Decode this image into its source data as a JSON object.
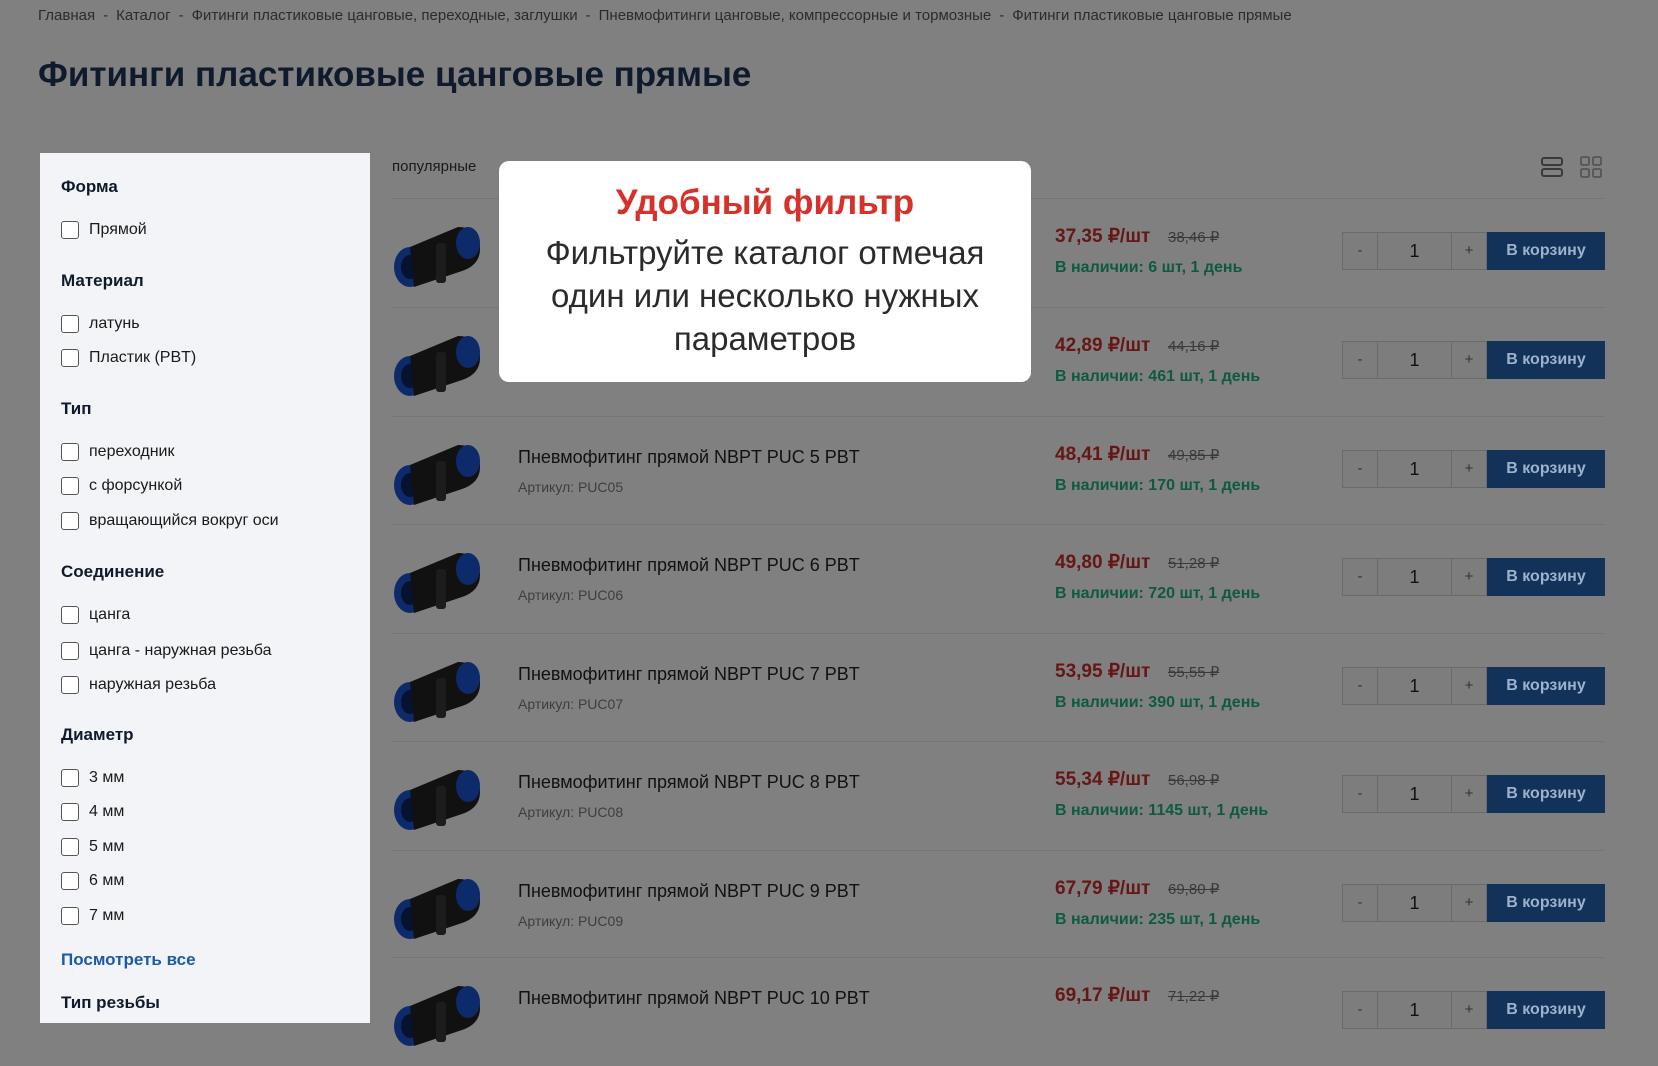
{
  "breadcrumb": [
    "Главная",
    "Каталог",
    "Фитинги пластиковые цанговые, переходные, заглушки",
    "Пневмофитинги цанговые, компрессорные и тормозные",
    "Фитинги пластиковые цанговые прямые"
  ],
  "page_title": "Фитинги пластиковые цанговые прямые",
  "filters": {
    "groups": [
      {
        "title": "Форма",
        "options": [
          "Прямой"
        ]
      },
      {
        "title": "Материал",
        "options": [
          "латунь",
          "Пластик (PBT)"
        ]
      },
      {
        "title": "Тип",
        "options": [
          "переходник",
          "с форсункой",
          "вращающийся вокруг оси"
        ]
      },
      {
        "title": "Соединение",
        "options": [
          "цанга",
          "цанга - наружная резьба",
          "наружная резьба"
        ]
      },
      {
        "title": "Диаметр",
        "options": [
          "3 мм",
          "4 мм",
          "5 мм",
          "6 мм",
          "7 мм"
        ]
      }
    ],
    "see_all": "Посмотреть все",
    "next_group_partial": "Тип резьбы"
  },
  "sort_label": "популярные",
  "view_icons": {
    "list": "list-view-icon",
    "grid": "grid-view-icon"
  },
  "products": [
    {
      "name": "",
      "sku": "",
      "price": "37,35 ₽/шт",
      "old_price": "38,46 ₽",
      "stock": "В наличии: 6 шт, 1 день",
      "qty": "1"
    },
    {
      "name": "",
      "sku": "",
      "price": "42,89 ₽/шт",
      "old_price": "44,16 ₽",
      "stock": "В наличии: 461 шт, 1 день",
      "qty": "1"
    },
    {
      "name": "Пневмофитинг прямой NBPT PUC 5 PBT",
      "sku": "Артикул: PUC05",
      "price": "48,41 ₽/шт",
      "old_price": "49,85 ₽",
      "stock": "В наличии: 170 шт, 1 день",
      "qty": "1"
    },
    {
      "name": "Пневмофитинг прямой NBPT PUC 6 PBT",
      "sku": "Артикул: PUC06",
      "price": "49,80 ₽/шт",
      "old_price": "51,28 ₽",
      "stock": "В наличии: 720 шт, 1 день",
      "qty": "1"
    },
    {
      "name": "Пневмофитинг прямой NBPT PUC 7 PBT",
      "sku": "Артикул: PUC07",
      "price": "53,95 ₽/шт",
      "old_price": "55,55 ₽",
      "stock": "В наличии: 390 шт, 1 день",
      "qty": "1"
    },
    {
      "name": "Пневмофитинг прямой NBPT PUC 8 PBT",
      "sku": "Артикул: PUC08",
      "price": "55,34 ₽/шт",
      "old_price": "56,98 ₽",
      "stock": "В наличии: 1145 шт, 1 день",
      "qty": "1"
    },
    {
      "name": "Пневмофитинг прямой NBPT PUC 9 PBT",
      "sku": "Артикул: PUC09",
      "price": "67,79 ₽/шт",
      "old_price": "69,80 ₽",
      "stock": "В наличии: 235 шт, 1 день",
      "qty": "1"
    },
    {
      "name": "Пневмофитинг прямой NBPT PUC 10 PBT",
      "sku": "",
      "price": "69,17 ₽/шт",
      "old_price": "71,22 ₽",
      "stock": "",
      "qty": "1"
    }
  ],
  "qty_minus": "-",
  "qty_plus": "+",
  "cart_button": "В корзину",
  "popup": {
    "title": "Удобный фильтр",
    "text": "Фильтруйте каталог отмечая один или несколько нужных параметров"
  },
  "colors": {
    "overlay": "#808080",
    "popup_title": "#d6312b",
    "price": "#661616",
    "stock": "#0e5a3e",
    "cart_button": "#13325a",
    "link": "#1b5aa6"
  }
}
